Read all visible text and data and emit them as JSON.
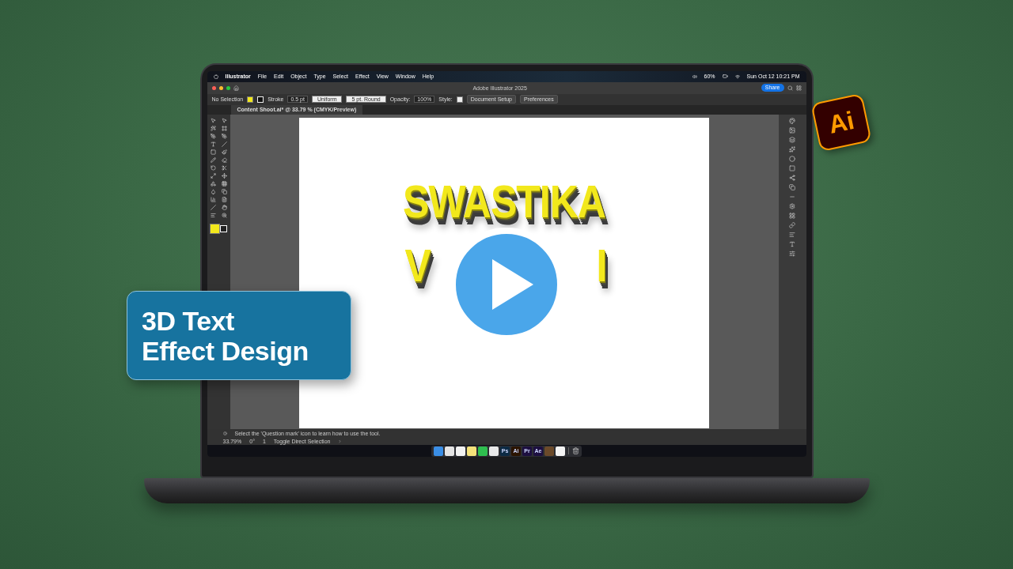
{
  "menu_bar": {
    "app": "Illustrator",
    "items": [
      "File",
      "Edit",
      "Object",
      "Type",
      "Select",
      "Effect",
      "View",
      "Window",
      "Help"
    ],
    "battery": "60%",
    "clock": "Sun Oct 12  10:21 PM"
  },
  "title_bar": {
    "title": "Adobe Illustrator 2025",
    "share": "Share"
  },
  "control_bar": {
    "selection": "No Selection",
    "stroke_label": "Stroke",
    "stroke_value": "0.5 pt",
    "stroke_style": "Uniform",
    "brush": "5 pt. Round",
    "opacity_label": "Opacity:",
    "opacity_value": "100%",
    "style_label": "Style:",
    "buttons": [
      "Document Setup",
      "Preferences"
    ]
  },
  "document_tab": {
    "title": "Content Shoot.ai* @ 33.79 % (CMYK/Preview)"
  },
  "artwork": {
    "line_1": "SWASTIKA",
    "line_2_fragments": [
      "V",
      "I"
    ]
  },
  "status_bar": {
    "hint": "Select the 'Question mark' icon to learn how to use the tool.",
    "zoom": "33.79%",
    "rotation": "0°",
    "artboard": "1",
    "tool": "Toggle Direct Selection"
  },
  "dock": {
    "items": [
      {
        "color": "#3a8ee6"
      },
      {
        "color": "#e4e4e4"
      },
      {
        "color": "#f2f2f2"
      },
      {
        "color": "#f5e27a"
      },
      {
        "color": "#2fbf4f"
      },
      {
        "color": "#e9e9e9"
      },
      {
        "label": "Ps",
        "color": "#0c2a44"
      },
      {
        "label": "Ai",
        "color": "#2b1400"
      },
      {
        "label": "Pr",
        "color": "#1d0f40"
      },
      {
        "label": "Ae",
        "color": "#1d0f40"
      },
      {
        "color": "#6b4a2a"
      },
      {
        "color": "#f4f4f4"
      }
    ]
  },
  "overlay_card": {
    "title_lines": [
      "3D Text",
      "Effect Design"
    ]
  },
  "app_badge": {
    "text": "Ai"
  }
}
